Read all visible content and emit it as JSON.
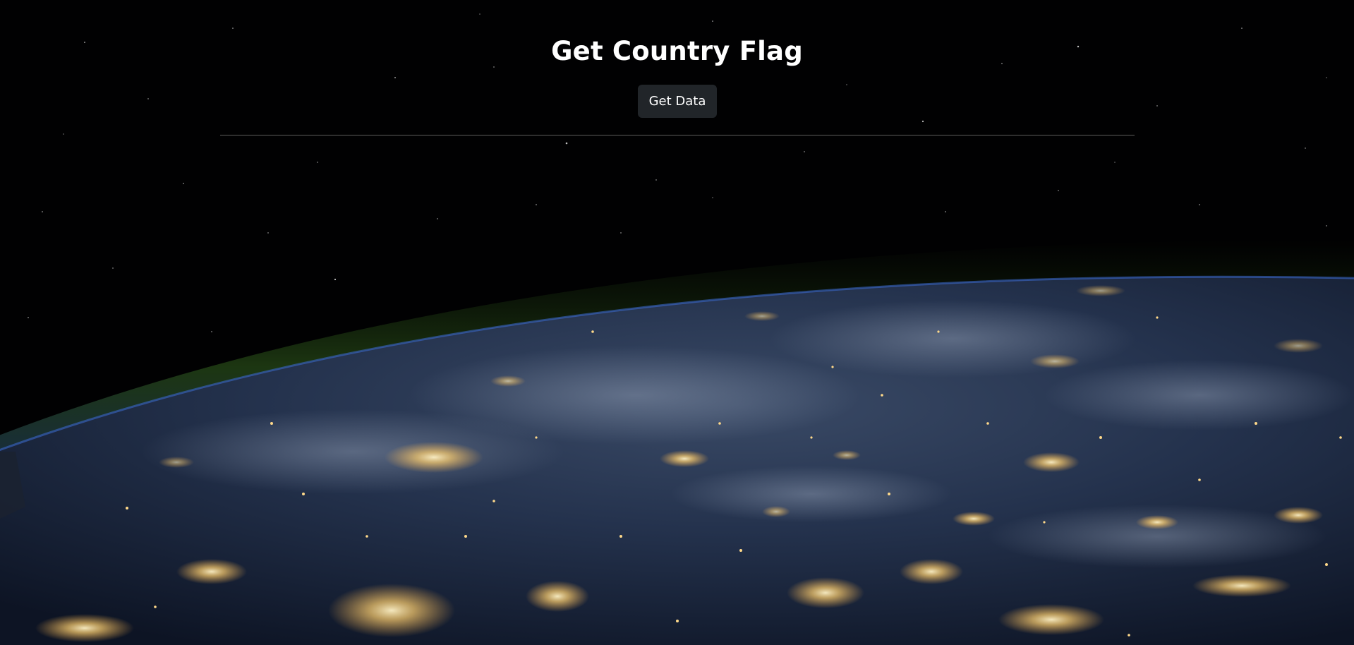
{
  "header": {
    "title": "Get Country Flag",
    "get_data_label": "Get Data"
  },
  "background": {
    "subject": "earth-at-night-from-space",
    "colors": {
      "space": "#010102",
      "atmosphere": "#2d5a1a",
      "ocean": "#1c2a45",
      "city_lights": "#ffd27a"
    }
  },
  "theme": {
    "button_bg": "#212529",
    "text": "#ffffff",
    "divider": "#5c5c5c"
  }
}
